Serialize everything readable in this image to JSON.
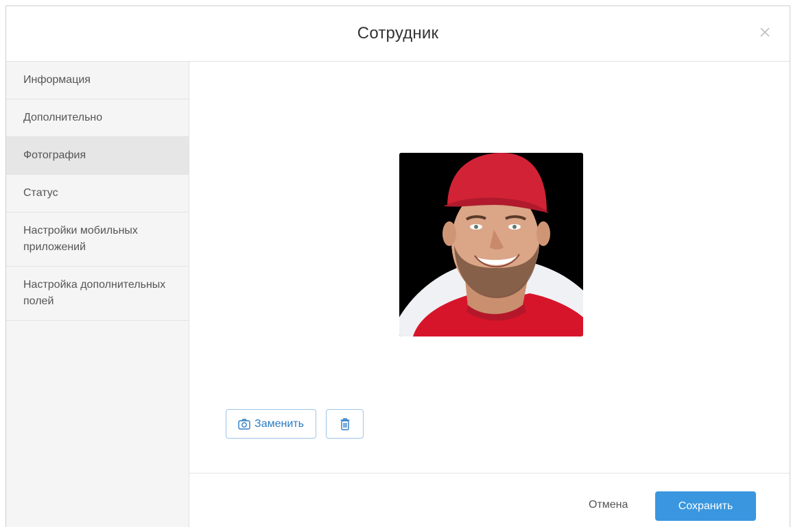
{
  "dialog": {
    "title": "Сотрудник",
    "close_icon": "close-icon"
  },
  "sidebar": {
    "items": [
      {
        "label": "Информация",
        "active": false
      },
      {
        "label": "Дополнительно",
        "active": false
      },
      {
        "label": "Фотография",
        "active": true
      },
      {
        "label": "Статус",
        "active": false
      },
      {
        "label": "Настройки мобильных приложений",
        "active": false
      },
      {
        "label": "Настройка дополнительных полей",
        "active": false
      }
    ]
  },
  "photo_panel": {
    "replace_label": "Заменить",
    "replace_icon": "camera-icon",
    "delete_icon": "trash-icon"
  },
  "footer": {
    "cancel_label": "Отмена",
    "save_label": "Сохранить"
  },
  "colors": {
    "primary": "#3a97df",
    "link": "#2b7bc4",
    "outline_border": "#9cc6ea",
    "sidebar_bg": "#f5f5f5",
    "sidebar_active_bg": "#e6e6e6",
    "cap_red": "#d22236",
    "shirt_red": "#d7152a"
  }
}
